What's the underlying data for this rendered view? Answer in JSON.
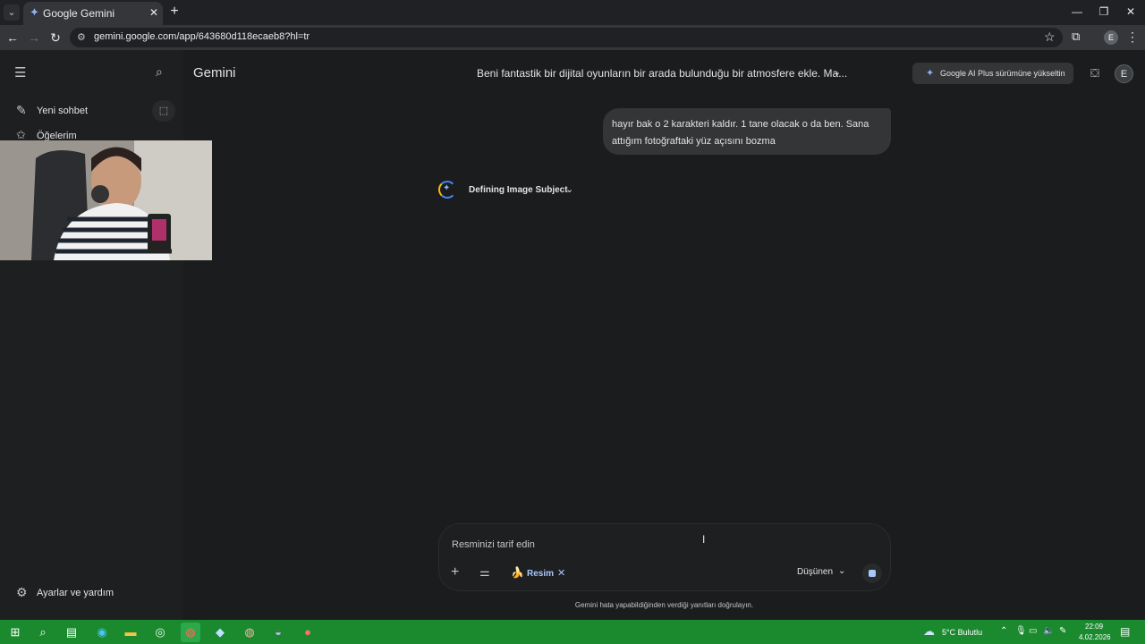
{
  "browser": {
    "tab_title": "Google Gemini",
    "url": "gemini.google.com/app/643680d118ecaeb8?hl=tr"
  },
  "sidebar": {
    "new_chat": "Yeni sohbet",
    "items": "Öğelerim",
    "settings": "Ayarlar ve yardım"
  },
  "header": {
    "app_title": "Gemini",
    "chat_title": "Beni fantastik bir dijital oyunların bir arada bulunduğu bir atmosfere ekle. Ma...",
    "upgrade_label": "Google AI Plus sürümüne yükseltin",
    "avatar_letter": "E"
  },
  "conversation": {
    "user_message": "hayır bak o 2 karakteri kaldır. 1 tane olacak o da ben. Sana attığım fotoğraftaki yüz açısını bozma",
    "thinking_label": "Defining Image Subject"
  },
  "composer": {
    "placeholder": "Resminizi tarif edin",
    "chip_label": "Resim",
    "mode_label": "Düşünen"
  },
  "footer": {
    "disclaimer": "Gemini hata yapabildiğinden verdiği yanıtları doğrulayın."
  },
  "taskbar": {
    "weather": "5°C  Bulutlu",
    "time": "22:09",
    "date": "4.02.2026"
  },
  "colors": {
    "background": "#1b1c1d",
    "sidebar": "#1e1f20",
    "taskbar": "#1b8a2f",
    "accent": "#a8c7fa"
  }
}
